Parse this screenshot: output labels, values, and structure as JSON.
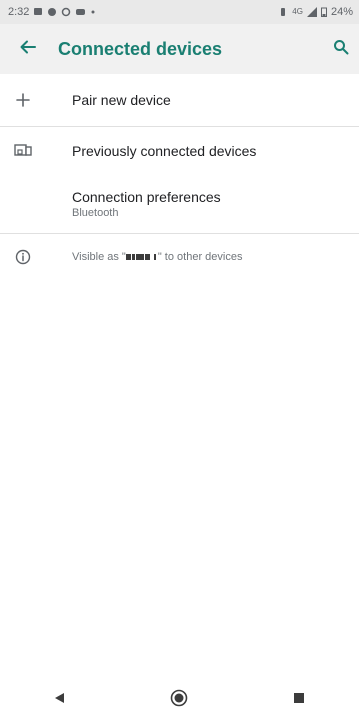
{
  "status_bar": {
    "time": "2:32",
    "network": "4G",
    "battery": "24%"
  },
  "header": {
    "title": "Connected devices"
  },
  "list": {
    "pair_label": "Pair new device",
    "previous_label": "Previously connected devices",
    "preferences_label": "Connection preferences",
    "preferences_sub": "Bluetooth",
    "visible_prefix": "Visible as \"",
    "visible_suffix": "\" to other devices"
  },
  "colors": {
    "accent": "#1a7f72",
    "app_bar_bg": "#f1f1f1",
    "status_bar_bg": "#e9e9e9",
    "text_secondary": "#70757a"
  },
  "icons": {
    "back": "arrow-left",
    "search": "magnifier",
    "pair": "plus",
    "previous": "devices",
    "info": "info-circle",
    "nav_back": "triangle-left",
    "nav_home": "circle",
    "nav_recents": "square"
  }
}
